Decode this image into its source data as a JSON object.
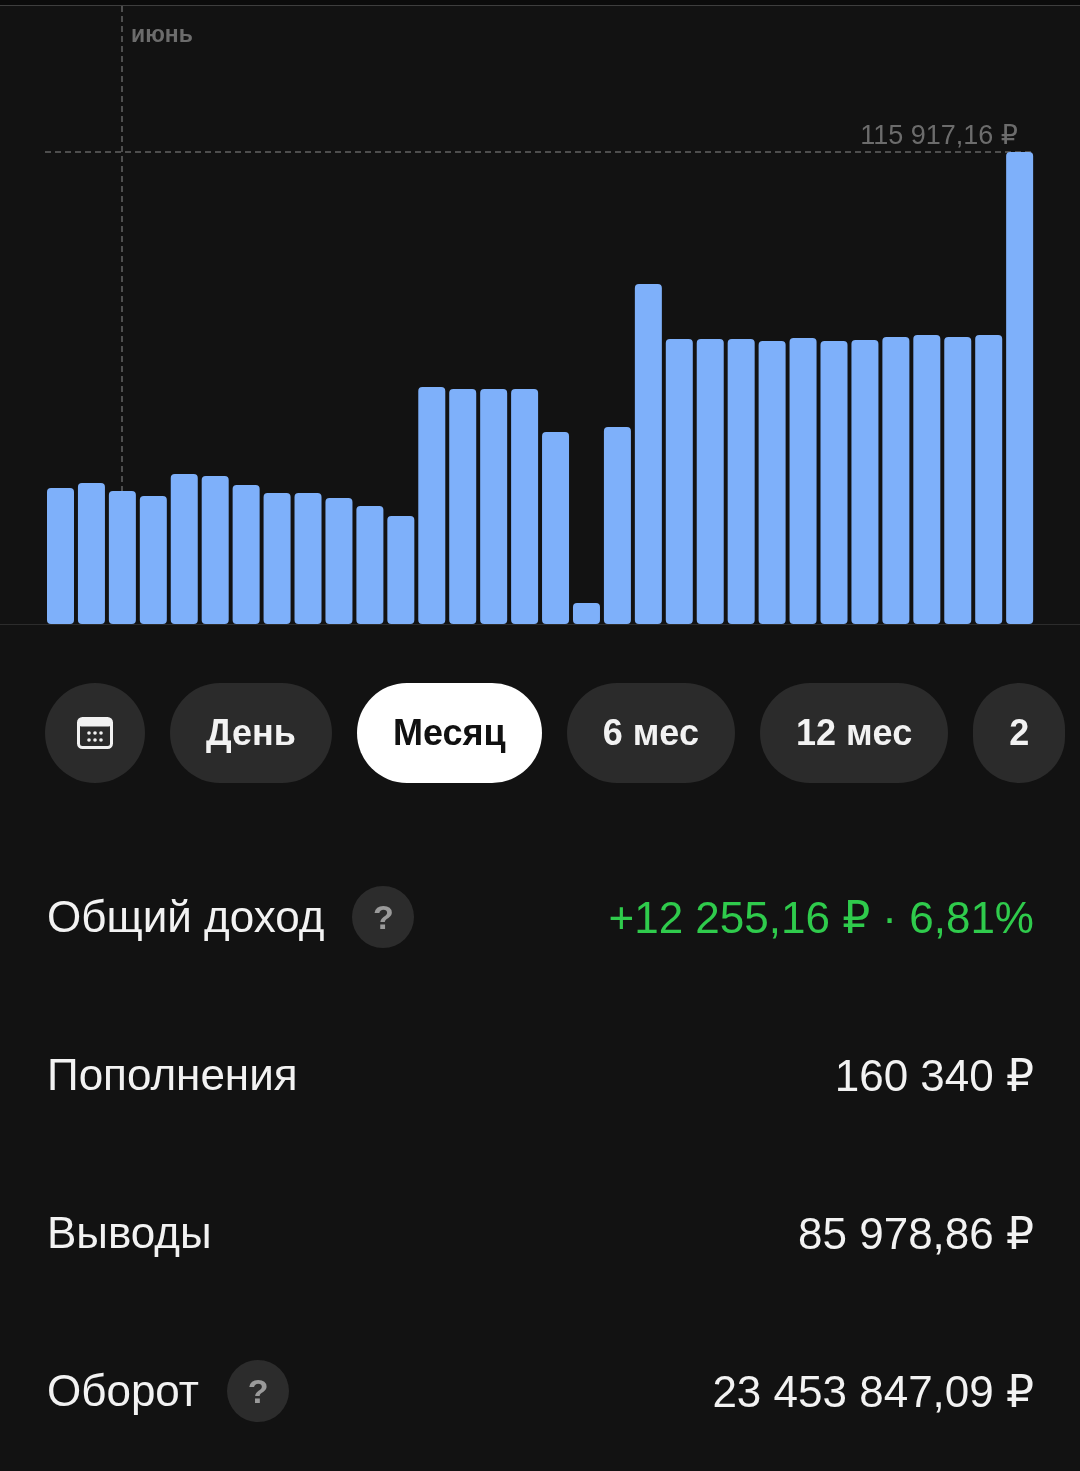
{
  "chart": {
    "period_label": "июнь",
    "max_label": "115 917,16 ₽"
  },
  "periods": [
    {
      "kind": "calendar",
      "selected": false
    },
    {
      "kind": "text",
      "label": "День",
      "selected": false
    },
    {
      "kind": "text",
      "label": "Месяц",
      "selected": true
    },
    {
      "kind": "text",
      "label": "6 мес",
      "selected": false
    },
    {
      "kind": "text",
      "label": "12 мес",
      "selected": false
    },
    {
      "kind": "text",
      "label": "2",
      "selected": false
    }
  ],
  "stats": [
    {
      "label": "Общий доход",
      "help": "?",
      "value": "+12 255,16 ₽ · 6,81%",
      "positive": true
    },
    {
      "label": "Пополнения",
      "value": "160 340 ₽",
      "positive": false
    },
    {
      "label": "Выводы",
      "value": "85 978,86 ₽",
      "positive": false
    },
    {
      "label": "Оборот",
      "help": "?",
      "value": "23 453 847,09 ₽",
      "positive": false
    }
  ]
}
